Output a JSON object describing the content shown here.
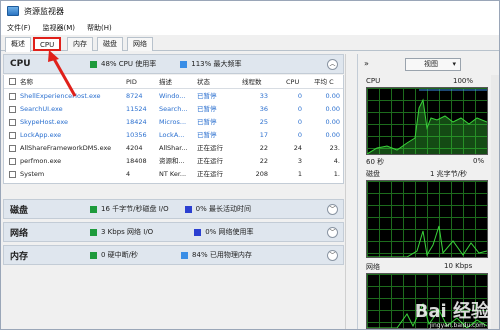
{
  "window": {
    "title": "资源监视器"
  },
  "menu": [
    "文件(F)",
    "监视器(M)",
    "帮助(H)"
  ],
  "tabs": [
    "概述",
    "CPU",
    "内存",
    "磁盘",
    "网络"
  ],
  "cpu_section": {
    "title": "CPU",
    "meter1": "48% CPU 使用率",
    "meter2": "113% 最大频率",
    "columns": [
      "名称",
      "PID",
      "描述",
      "状态",
      "线程数",
      "CPU",
      "平均 C"
    ],
    "rows": [
      {
        "name": "ShellExperienceHost.exe",
        "pid": "8724",
        "desc": "Windo...",
        "status": "已暂停",
        "threads": "33",
        "cpu": "0",
        "avg": "0.00",
        "suspended": true
      },
      {
        "name": "SearchUI.exe",
        "pid": "11524",
        "desc": "Search...",
        "status": "已暂停",
        "threads": "36",
        "cpu": "0",
        "avg": "0.00",
        "suspended": true
      },
      {
        "name": "SkypeHost.exe",
        "pid": "18424",
        "desc": "Micros...",
        "status": "已暂停",
        "threads": "25",
        "cpu": "0",
        "avg": "0.00",
        "suspended": true
      },
      {
        "name": "LockApp.exe",
        "pid": "10356",
        "desc": "LockA...",
        "status": "已暂停",
        "threads": "17",
        "cpu": "0",
        "avg": "0.00",
        "suspended": true
      },
      {
        "name": "AllShareFrameworkDMS.exe",
        "pid": "4204",
        "desc": "AllShar...",
        "status": "正在运行",
        "threads": "22",
        "cpu": "24",
        "avg": "23.",
        "suspended": false
      },
      {
        "name": "perfmon.exe",
        "pid": "18408",
        "desc": "资源和...",
        "status": "正在运行",
        "threads": "22",
        "cpu": "3",
        "avg": "4.",
        "suspended": false
      },
      {
        "name": "System",
        "pid": "4",
        "desc": "NT Ker...",
        "status": "正在运行",
        "threads": "208",
        "cpu": "1",
        "avg": "1.",
        "suspended": false
      }
    ]
  },
  "disk_section": {
    "title": "磁盘",
    "meter1": "16 千字节/秒磁盘 I/O",
    "meter2": "0% 最长活动时间"
  },
  "network_section": {
    "title": "网络",
    "meter1": "3 Kbps 网络 I/O",
    "meter2": "0% 网络使用率"
  },
  "memory_section": {
    "title": "内存",
    "meter1": "0 硬中断/秒",
    "meter2": "84% 已用物理内存"
  },
  "right_panel": {
    "view_label": "视图",
    "cpu_label": "CPU",
    "cpu_value": "100%",
    "cpu_time": "60 秒",
    "cpu_bottom": "0%",
    "disk_label": "磁盘",
    "disk_value": "1 兆字节/秒",
    "net_label": "网络",
    "net_value": "10 Kbps"
  },
  "colors": {
    "green": "#1e9b3c",
    "blue": "#3a8ee6",
    "status_blue": "#2a6fcf",
    "highlight": "#e0201a"
  },
  "watermark": {
    "brand": "Bai 经验",
    "url": "jingyan.baidu.com"
  }
}
